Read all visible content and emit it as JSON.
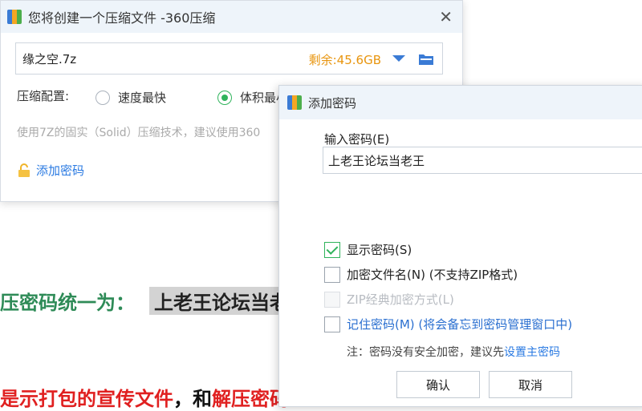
{
  "background": {
    "line1_prefix": "压密码统一为：",
    "line1_highlight": "上老王论坛当老",
    "line2_red": "是示打包的宣传文件",
    "line2_black": "，和",
    "line2_red2": "解压密码"
  },
  "main_window": {
    "title": "您将创建一个压缩文件 -360压缩",
    "close": "✕",
    "filename": "缘之空.7z",
    "free_space": "剩余:45.6GB",
    "config_label": "压缩配置:",
    "option_speed": "速度最快",
    "option_size": "体积最小",
    "description": "使用7Z的固实（Solid）压缩技术，建议使用360",
    "add_password": "添加密码"
  },
  "password_dialog": {
    "title": "添加密码",
    "input_label": "输入密码(E)",
    "password_value": "上老王论坛当老王",
    "show_password": "显示密码(S)",
    "encrypt_filename": "加密文件名(N) (不支持ZIP格式)",
    "zip_classic": "ZIP经典加密方式(L)",
    "remember_password": "记住密码(M) (将会备忘到密码管理窗口中)",
    "note_prefix": "注：密码没有安全加密，建议先",
    "note_link": "设置主密码",
    "ok": "确认",
    "cancel": "取消"
  },
  "colors": {
    "accent_blue": "#2a7ae2",
    "check_green": "#2fb35b",
    "free_space_orange": "#e8950e",
    "bg_green_text": "#2e8b57",
    "bg_red_text": "#e02020"
  }
}
